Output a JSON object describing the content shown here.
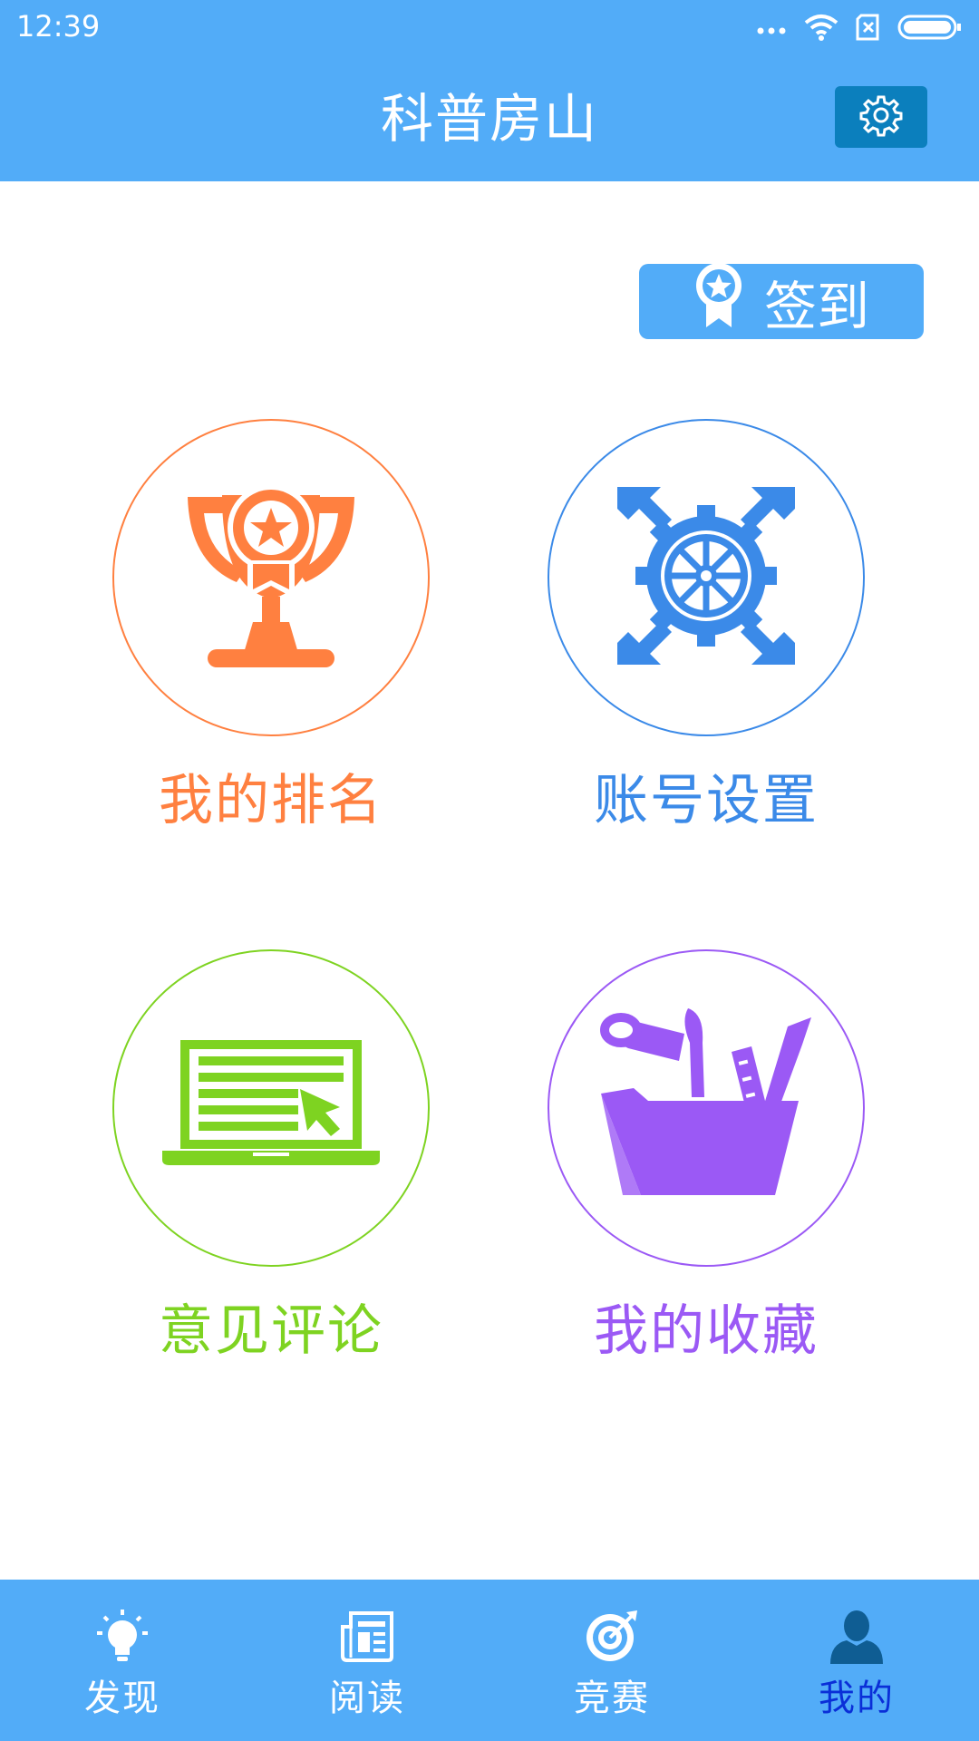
{
  "status_bar": {
    "time": "12:39"
  },
  "header": {
    "title": "科普房山"
  },
  "checkin": {
    "label": "签到"
  },
  "tiles": [
    {
      "label": "我的排名",
      "color": "#ff8040",
      "icon": "trophy-icon"
    },
    {
      "label": "账号设置",
      "color": "#3b8ae8",
      "icon": "gear-expand-icon"
    },
    {
      "label": "意见评论",
      "color": "#7ed321",
      "icon": "laptop-cursor-icon"
    },
    {
      "label": "我的收藏",
      "color": "#9b59f5",
      "icon": "folder-tools-icon"
    }
  ],
  "bottom_nav": {
    "items": [
      {
        "label": "发现",
        "icon": "lightbulb-icon",
        "active": false
      },
      {
        "label": "阅读",
        "icon": "newspaper-icon",
        "active": false
      },
      {
        "label": "竞赛",
        "icon": "target-icon",
        "active": false
      },
      {
        "label": "我的",
        "icon": "person-icon",
        "active": true
      }
    ]
  },
  "colors": {
    "primary": "#52acf8",
    "settings_button": "#0b7fbd",
    "active_nav": "#0a2fd8"
  }
}
